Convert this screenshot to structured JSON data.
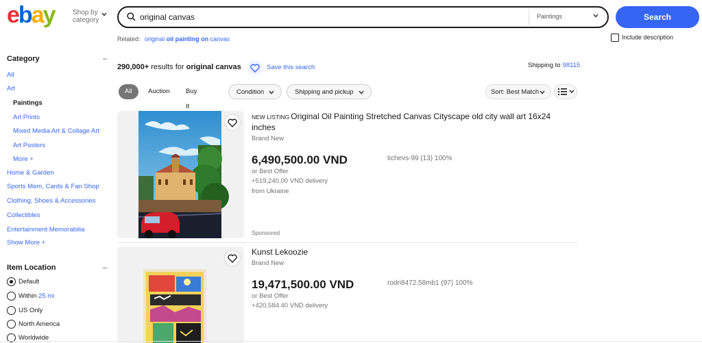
{
  "header": {
    "logo_letters": [
      "e",
      "b",
      "a",
      "y"
    ],
    "logo_colors": [
      "#e53238",
      "#0064d2",
      "#f5af02",
      "#86b817"
    ],
    "shop_by_line1": "Shop by",
    "shop_by_line2": "category",
    "search_value": "original canvas",
    "search_category": "Paintings",
    "search_button": "Search",
    "related_label": "Related:",
    "related_link_pre": "original",
    "related_link_bold": "oil painting on",
    "related_link_post": "canvas",
    "include_description": "Include description"
  },
  "sidebar": {
    "category_heading": "Category",
    "categories": [
      "All",
      "Art",
      "Paintings",
      "Art Prints",
      "Mixed Media Art & Collage Art",
      "Art Posters",
      "More +",
      "Home & Garden",
      "Sports Mem, Cards & Fan Shop",
      "Clothing, Shoes & Accessories",
      "Collectibles",
      "Entertainment Memorabilia",
      "Show More +"
    ],
    "location_heading": "Item Location",
    "locations": [
      {
        "label": "Default",
        "extra": ""
      },
      {
        "label": "Within",
        "extra": "25 mi"
      },
      {
        "label": "US Only",
        "extra": ""
      },
      {
        "label": "North America",
        "extra": ""
      },
      {
        "label": "Worldwide",
        "extra": ""
      }
    ]
  },
  "results": {
    "count": "290,000+",
    "count_mid": "results for",
    "query": "original canvas",
    "save_search": "Save this search",
    "shipping_to_label": "Shipping to",
    "zip": "98115"
  },
  "filters": {
    "formats": [
      "All",
      "Auction",
      "Buy It Now"
    ],
    "condition": "Condition",
    "shipping": "Shipping and pickup",
    "sort": "Sort: Best Match"
  },
  "items": [
    {
      "badge": "NEW LISTING",
      "title": "Original Oil Painting Stretched Canvas Cityscape old city wall art 16x24 inches",
      "condition": "Brand New",
      "price": "6,490,500.00 VND",
      "seller": "tichevs-99 (13) 100%",
      "best_offer": "or Best Offer",
      "delivery": "+519,240.00 VND delivery",
      "origin": "from Ukraine",
      "sponsored": "Sponsored"
    },
    {
      "title": "Kunst Lekoozie",
      "condition": "Brand New",
      "price": "19,471,500.00 VND",
      "seller": "rodri8472.58mb1 (97) 100%",
      "best_offer": "or Best Offer",
      "delivery": "+420,584.40 VND delivery"
    }
  ]
}
